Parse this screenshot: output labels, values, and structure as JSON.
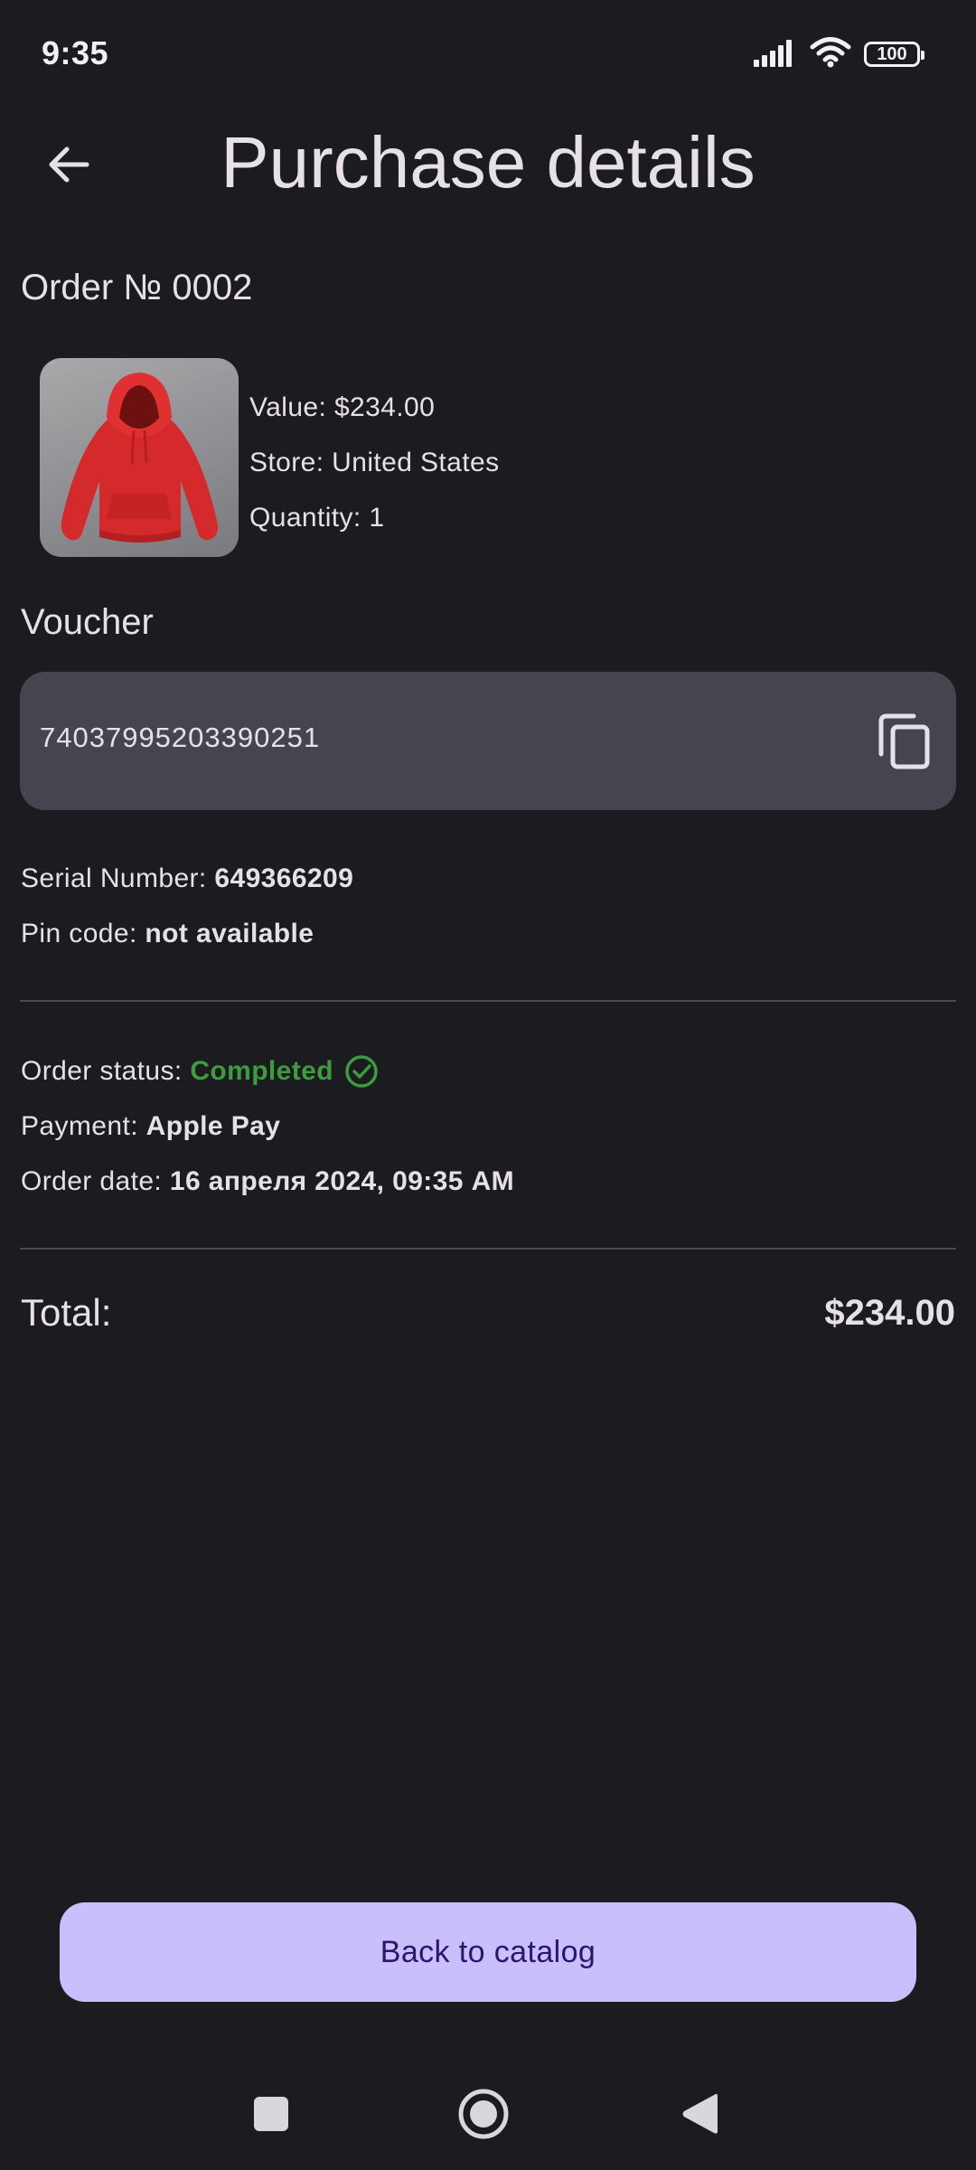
{
  "status_bar": {
    "time": "9:35",
    "battery": "100",
    "icons": [
      "signal-icon",
      "wifi-icon",
      "battery-icon"
    ]
  },
  "header": {
    "title": "Purchase details",
    "back_icon": "arrow-left-icon"
  },
  "order": {
    "number_label": "Order № 0002",
    "product_image": "red-hoodie",
    "value": "Value: $234.00",
    "store": "Store: United States",
    "quantity": "Quantity: 1"
  },
  "voucher": {
    "label": "Voucher",
    "code": "74037995203390251",
    "copy_icon": "copy-icon"
  },
  "codes": {
    "serial_label": "Serial Number: ",
    "serial_value": "649366209",
    "pin_label": "Pin code: ",
    "pin_value": "not available"
  },
  "status": {
    "order_status_label": "Order status: ",
    "order_status_value": "Completed",
    "status_icon": "check-circle-icon",
    "payment_label": "Payment: ",
    "payment_value": "Apple Pay",
    "date_label": "Order date: ",
    "date_value": "16 апреля 2024, 09:35 AM"
  },
  "total": {
    "label": "Total:",
    "value": "$234.00"
  },
  "actions": {
    "back_to_catalog": "Back to catalog"
  },
  "colors": {
    "background": "#1c1b20",
    "surface": "#46454f",
    "accent": "#c8bffc",
    "accent_text": "#2b1571",
    "success": "#3c9d3e"
  },
  "nav": {
    "recents_icon": "square-icon",
    "home_icon": "home-circle-icon",
    "back_icon": "triangle-back-icon"
  }
}
